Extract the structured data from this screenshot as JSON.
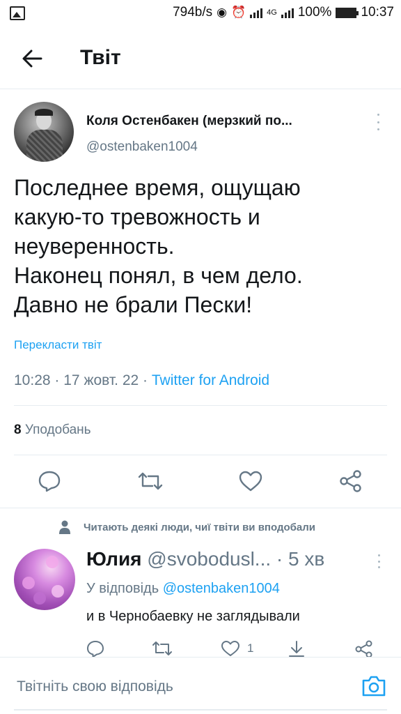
{
  "status_bar": {
    "speed": "794b/s",
    "network": "4G",
    "battery": "100%",
    "time": "10:37"
  },
  "header": {
    "title": "Твіт"
  },
  "tweet": {
    "author_name": "Коля Остенбакен (мерзкий по...",
    "author_handle": "@ostenbaken1004",
    "text_lines": [
      "Последнее время, ощущаю",
      "какую-то тревожность и",
      "неуверенность.",
      "Наконец понял, в чем дело.",
      "Давно не брали Пески!"
    ],
    "translate_label": "Перекласти твіт",
    "time": "10:28",
    "date": "17 жовт. 22",
    "separator": "·",
    "source": "Twitter for Android",
    "likes_count": "8",
    "likes_label": "Уподобань"
  },
  "context_label": "Читають деякі люди, чиї твіти ви вподобали",
  "reply": {
    "name": "Юлия",
    "handle": "@svobodusl...",
    "time": "· 5 хв",
    "reply_to_prefix": "У відповідь",
    "reply_to_handle": "@ostenbaken1004",
    "text": "и в Чернобаевку не заглядывали",
    "like_count": "1"
  },
  "compose": {
    "placeholder": "Твітніть свою відповідь"
  },
  "colors": {
    "accent": "#1da1f2",
    "secondary_text": "#657786",
    "primary_text": "#14171a",
    "divider": "#e6ecf0"
  },
  "icons": {
    "back": "arrow-left-icon",
    "reply": "reply-icon",
    "retweet": "retweet-icon",
    "like": "heart-icon",
    "share": "share-icon",
    "more": "more-vertical-icon",
    "person": "person-icon",
    "camera": "camera-icon"
  }
}
